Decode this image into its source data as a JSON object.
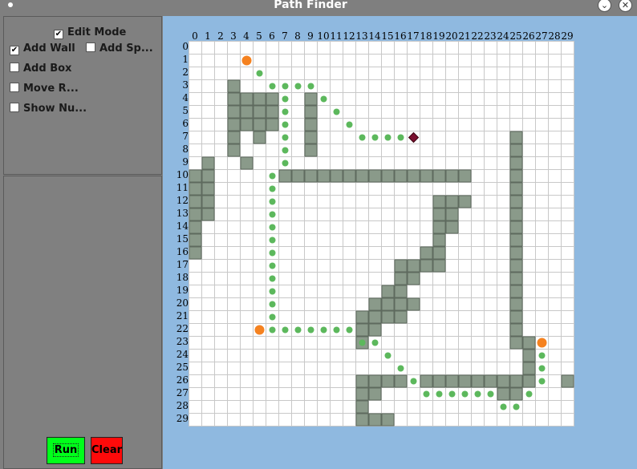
{
  "window": {
    "title": "Path Finder"
  },
  "controls": {
    "edit_mode": {
      "label": "Edit Mode",
      "checked": true
    },
    "add_wall": {
      "label": "Add Wall",
      "checked": true
    },
    "add_special": {
      "label": "Add Sp...",
      "checked": false
    },
    "add_box": {
      "label": "Add Box",
      "checked": false
    },
    "move_robot": {
      "label": "Move R...",
      "checked": false
    },
    "show_numbers": {
      "label": "Show Nu...",
      "checked": false
    }
  },
  "buttons": {
    "run_label": "Run",
    "clear_label": "Clear"
  },
  "colors": {
    "run": "#00ff1a",
    "clear": "#ff0a0a",
    "wall": "#8a9a8a",
    "path_dot": "#5cb85c",
    "waypoint": "#f58220",
    "target": "#7a1030",
    "grid_bg": "#8fb9e0"
  },
  "grid": {
    "cols": 30,
    "rows": 30,
    "col_labels": [
      "0",
      "1",
      "2",
      "3",
      "4",
      "5",
      "6",
      "7",
      "8",
      "9",
      "10",
      "11",
      "12",
      "13",
      "14",
      "15",
      "16",
      "17",
      "18",
      "19",
      "20",
      "21",
      "22",
      "23",
      "24",
      "25",
      "26",
      "27",
      "28",
      "29"
    ],
    "row_labels": [
      "0",
      "1",
      "2",
      "3",
      "4",
      "5",
      "6",
      "7",
      "8",
      "9",
      "10",
      "11",
      "12",
      "13",
      "14",
      "15",
      "16",
      "17",
      "18",
      "19",
      "20",
      "21",
      "22",
      "23",
      "24",
      "25",
      "26",
      "27",
      "28",
      "29"
    ],
    "walls": [
      [
        3,
        3
      ],
      [
        4,
        3
      ],
      [
        4,
        4
      ],
      [
        4,
        5
      ],
      [
        4,
        6
      ],
      [
        5,
        3
      ],
      [
        5,
        4
      ],
      [
        5,
        5
      ],
      [
        5,
        6
      ],
      [
        6,
        3
      ],
      [
        6,
        4
      ],
      [
        6,
        5
      ],
      [
        6,
        6
      ],
      [
        7,
        3
      ],
      [
        7,
        5
      ],
      [
        8,
        3
      ],
      [
        9,
        4
      ],
      [
        4,
        9
      ],
      [
        5,
        9
      ],
      [
        6,
        9
      ],
      [
        7,
        9
      ],
      [
        8,
        9
      ],
      [
        9,
        1
      ],
      [
        10,
        0
      ],
      [
        10,
        1
      ],
      [
        11,
        0
      ],
      [
        11,
        1
      ],
      [
        12,
        0
      ],
      [
        12,
        1
      ],
      [
        13,
        0
      ],
      [
        13,
        1
      ],
      [
        14,
        0
      ],
      [
        15,
        0
      ],
      [
        16,
        0
      ],
      [
        10,
        7
      ],
      [
        10,
        8
      ],
      [
        10,
        9
      ],
      [
        10,
        10
      ],
      [
        10,
        11
      ],
      [
        10,
        12
      ],
      [
        10,
        13
      ],
      [
        10,
        14
      ],
      [
        10,
        15
      ],
      [
        10,
        16
      ],
      [
        10,
        17
      ],
      [
        10,
        18
      ],
      [
        10,
        19
      ],
      [
        10,
        20
      ],
      [
        10,
        21
      ],
      [
        7,
        25
      ],
      [
        8,
        25
      ],
      [
        9,
        25
      ],
      [
        10,
        25
      ],
      [
        11,
        25
      ],
      [
        12,
        25
      ],
      [
        13,
        25
      ],
      [
        14,
        25
      ],
      [
        15,
        25
      ],
      [
        16,
        25
      ],
      [
        17,
        25
      ],
      [
        18,
        25
      ],
      [
        19,
        25
      ],
      [
        20,
        25
      ],
      [
        21,
        25
      ],
      [
        22,
        25
      ],
      [
        23,
        25
      ],
      [
        12,
        19
      ],
      [
        12,
        20
      ],
      [
        12,
        21
      ],
      [
        13,
        19
      ],
      [
        13,
        20
      ],
      [
        14,
        19
      ],
      [
        14,
        20
      ],
      [
        15,
        19
      ],
      [
        16,
        18
      ],
      [
        16,
        19
      ],
      [
        17,
        16
      ],
      [
        17,
        17
      ],
      [
        17,
        18
      ],
      [
        17,
        19
      ],
      [
        18,
        16
      ],
      [
        18,
        17
      ],
      [
        19,
        15
      ],
      [
        19,
        16
      ],
      [
        20,
        14
      ],
      [
        20,
        15
      ],
      [
        20,
        16
      ],
      [
        20,
        17
      ],
      [
        21,
        13
      ],
      [
        21,
        14
      ],
      [
        21,
        15
      ],
      [
        21,
        16
      ],
      [
        22,
        13
      ],
      [
        22,
        14
      ],
      [
        23,
        13
      ],
      [
        23,
        26
      ],
      [
        24,
        26
      ],
      [
        25,
        26
      ],
      [
        26,
        26
      ],
      [
        26,
        13
      ],
      [
        26,
        14
      ],
      [
        26,
        15
      ],
      [
        26,
        16
      ],
      [
        26,
        18
      ],
      [
        26,
        19
      ],
      [
        26,
        20
      ],
      [
        26,
        21
      ],
      [
        26,
        22
      ],
      [
        26,
        23
      ],
      [
        26,
        24
      ],
      [
        26,
        25
      ],
      [
        26,
        29
      ],
      [
        27,
        13
      ],
      [
        27,
        14
      ],
      [
        27,
        24
      ],
      [
        27,
        25
      ],
      [
        28,
        13
      ],
      [
        29,
        13
      ],
      [
        29,
        14
      ],
      [
        29,
        15
      ]
    ],
    "path": [
      [
        2,
        5
      ],
      [
        3,
        6
      ],
      [
        3,
        7
      ],
      [
        3,
        8
      ],
      [
        3,
        9
      ],
      [
        4,
        10
      ],
      [
        5,
        11
      ],
      [
        6,
        12
      ],
      [
        7,
        13
      ],
      [
        7,
        14
      ],
      [
        7,
        15
      ],
      [
        7,
        16
      ],
      [
        4,
        7
      ],
      [
        5,
        7
      ],
      [
        6,
        7
      ],
      [
        7,
        7
      ],
      [
        8,
        7
      ],
      [
        9,
        7
      ],
      [
        10,
        6
      ],
      [
        11,
        6
      ],
      [
        12,
        6
      ],
      [
        13,
        6
      ],
      [
        14,
        6
      ],
      [
        15,
        6
      ],
      [
        16,
        6
      ],
      [
        17,
        6
      ],
      [
        18,
        6
      ],
      [
        19,
        6
      ],
      [
        20,
        6
      ],
      [
        21,
        6
      ],
      [
        22,
        6
      ],
      [
        22,
        7
      ],
      [
        22,
        8
      ],
      [
        22,
        9
      ],
      [
        22,
        10
      ],
      [
        22,
        11
      ],
      [
        22,
        12
      ],
      [
        23,
        13
      ],
      [
        23,
        14
      ],
      [
        24,
        15
      ],
      [
        25,
        16
      ],
      [
        26,
        17
      ],
      [
        27,
        18
      ],
      [
        27,
        19
      ],
      [
        27,
        20
      ],
      [
        27,
        21
      ],
      [
        27,
        22
      ],
      [
        27,
        23
      ],
      [
        28,
        24
      ],
      [
        28,
        25
      ],
      [
        27,
        26
      ],
      [
        26,
        27
      ],
      [
        25,
        27
      ],
      [
        24,
        27
      ]
    ],
    "waypoints": [
      [
        1,
        4
      ],
      [
        22,
        5
      ],
      [
        23,
        27
      ]
    ],
    "target": [
      7,
      17
    ]
  }
}
